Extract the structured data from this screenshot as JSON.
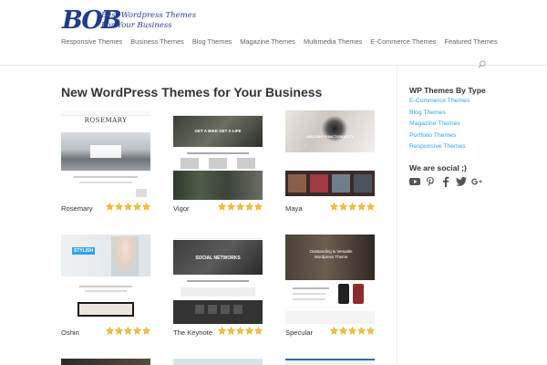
{
  "logo": {
    "mark": "BOB",
    "tagline_line1": "Best Wordpress Themes",
    "tagline_line2": "For Your Business"
  },
  "nav": [
    "Responsive Themes",
    "Business Themes",
    "Blog Themes",
    "Magazine Themes",
    "Multimedia Themes",
    "E-Commerce Themes",
    "Featured Themes"
  ],
  "main": {
    "title": "New WordPress Themes for Your Business",
    "themes": [
      {
        "name": "Rosemary",
        "rating": 5,
        "thumb_text": "ROSEMARY"
      },
      {
        "name": "Vigor",
        "rating": 5,
        "thumb_text": "GET A BIKE GET A LIFE"
      },
      {
        "name": "Maya",
        "rating": 5,
        "thumb_text": "AMAZING FUNCTIONALITY"
      },
      {
        "name": "Oshin",
        "rating": 5,
        "thumb_text": "STYLISH"
      },
      {
        "name": "The Keynote",
        "rating": 5,
        "thumb_text": "SOCIAL NETWORKS"
      },
      {
        "name": "Specular",
        "rating": 5,
        "thumb_text": "Outstanding & Versatile Wordpress Theme"
      }
    ]
  },
  "sidebar": {
    "types_heading": "WP Themes By Type",
    "types": [
      "E-Commerce Themes",
      "Blog Themes",
      "Magazine Themes",
      "Portfolio Themes",
      "Responsive Themes"
    ],
    "social_heading": "We are social ;)",
    "social_icons": [
      "youtube-icon",
      "pinterest-icon",
      "facebook-icon",
      "twitter-icon",
      "google-plus-icon"
    ]
  },
  "colors": {
    "link": "#2ea3f2",
    "star": "#f3c130",
    "logo": "#1f3d8a"
  }
}
